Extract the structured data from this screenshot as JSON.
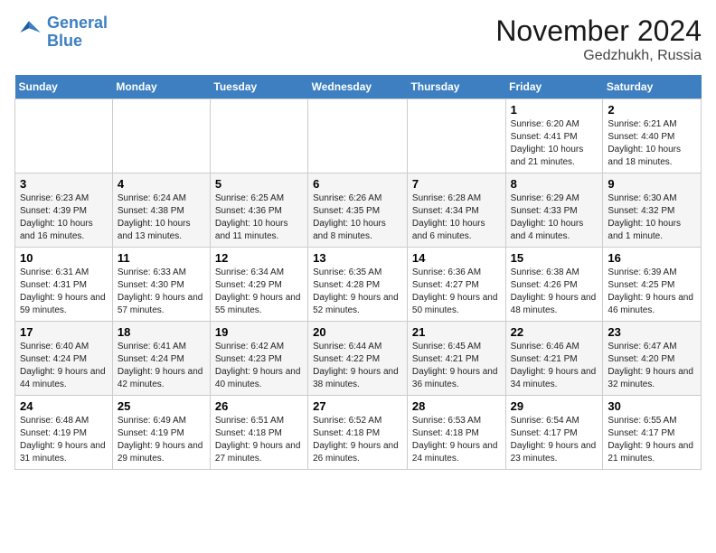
{
  "header": {
    "logo_line1": "General",
    "logo_line2": "Blue",
    "month_title": "November 2024",
    "location": "Gedzhukh, Russia"
  },
  "weekdays": [
    "Sunday",
    "Monday",
    "Tuesday",
    "Wednesday",
    "Thursday",
    "Friday",
    "Saturday"
  ],
  "weeks": [
    [
      {
        "day": "",
        "info": ""
      },
      {
        "day": "",
        "info": ""
      },
      {
        "day": "",
        "info": ""
      },
      {
        "day": "",
        "info": ""
      },
      {
        "day": "",
        "info": ""
      },
      {
        "day": "1",
        "info": "Sunrise: 6:20 AM\nSunset: 4:41 PM\nDaylight: 10 hours and 21 minutes."
      },
      {
        "day": "2",
        "info": "Sunrise: 6:21 AM\nSunset: 4:40 PM\nDaylight: 10 hours and 18 minutes."
      }
    ],
    [
      {
        "day": "3",
        "info": "Sunrise: 6:23 AM\nSunset: 4:39 PM\nDaylight: 10 hours and 16 minutes."
      },
      {
        "day": "4",
        "info": "Sunrise: 6:24 AM\nSunset: 4:38 PM\nDaylight: 10 hours and 13 minutes."
      },
      {
        "day": "5",
        "info": "Sunrise: 6:25 AM\nSunset: 4:36 PM\nDaylight: 10 hours and 11 minutes."
      },
      {
        "day": "6",
        "info": "Sunrise: 6:26 AM\nSunset: 4:35 PM\nDaylight: 10 hours and 8 minutes."
      },
      {
        "day": "7",
        "info": "Sunrise: 6:28 AM\nSunset: 4:34 PM\nDaylight: 10 hours and 6 minutes."
      },
      {
        "day": "8",
        "info": "Sunrise: 6:29 AM\nSunset: 4:33 PM\nDaylight: 10 hours and 4 minutes."
      },
      {
        "day": "9",
        "info": "Sunrise: 6:30 AM\nSunset: 4:32 PM\nDaylight: 10 hours and 1 minute."
      }
    ],
    [
      {
        "day": "10",
        "info": "Sunrise: 6:31 AM\nSunset: 4:31 PM\nDaylight: 9 hours and 59 minutes."
      },
      {
        "day": "11",
        "info": "Sunrise: 6:33 AM\nSunset: 4:30 PM\nDaylight: 9 hours and 57 minutes."
      },
      {
        "day": "12",
        "info": "Sunrise: 6:34 AM\nSunset: 4:29 PM\nDaylight: 9 hours and 55 minutes."
      },
      {
        "day": "13",
        "info": "Sunrise: 6:35 AM\nSunset: 4:28 PM\nDaylight: 9 hours and 52 minutes."
      },
      {
        "day": "14",
        "info": "Sunrise: 6:36 AM\nSunset: 4:27 PM\nDaylight: 9 hours and 50 minutes."
      },
      {
        "day": "15",
        "info": "Sunrise: 6:38 AM\nSunset: 4:26 PM\nDaylight: 9 hours and 48 minutes."
      },
      {
        "day": "16",
        "info": "Sunrise: 6:39 AM\nSunset: 4:25 PM\nDaylight: 9 hours and 46 minutes."
      }
    ],
    [
      {
        "day": "17",
        "info": "Sunrise: 6:40 AM\nSunset: 4:24 PM\nDaylight: 9 hours and 44 minutes."
      },
      {
        "day": "18",
        "info": "Sunrise: 6:41 AM\nSunset: 4:24 PM\nDaylight: 9 hours and 42 minutes."
      },
      {
        "day": "19",
        "info": "Sunrise: 6:42 AM\nSunset: 4:23 PM\nDaylight: 9 hours and 40 minutes."
      },
      {
        "day": "20",
        "info": "Sunrise: 6:44 AM\nSunset: 4:22 PM\nDaylight: 9 hours and 38 minutes."
      },
      {
        "day": "21",
        "info": "Sunrise: 6:45 AM\nSunset: 4:21 PM\nDaylight: 9 hours and 36 minutes."
      },
      {
        "day": "22",
        "info": "Sunrise: 6:46 AM\nSunset: 4:21 PM\nDaylight: 9 hours and 34 minutes."
      },
      {
        "day": "23",
        "info": "Sunrise: 6:47 AM\nSunset: 4:20 PM\nDaylight: 9 hours and 32 minutes."
      }
    ],
    [
      {
        "day": "24",
        "info": "Sunrise: 6:48 AM\nSunset: 4:19 PM\nDaylight: 9 hours and 31 minutes."
      },
      {
        "day": "25",
        "info": "Sunrise: 6:49 AM\nSunset: 4:19 PM\nDaylight: 9 hours and 29 minutes."
      },
      {
        "day": "26",
        "info": "Sunrise: 6:51 AM\nSunset: 4:18 PM\nDaylight: 9 hours and 27 minutes."
      },
      {
        "day": "27",
        "info": "Sunrise: 6:52 AM\nSunset: 4:18 PM\nDaylight: 9 hours and 26 minutes."
      },
      {
        "day": "28",
        "info": "Sunrise: 6:53 AM\nSunset: 4:18 PM\nDaylight: 9 hours and 24 minutes."
      },
      {
        "day": "29",
        "info": "Sunrise: 6:54 AM\nSunset: 4:17 PM\nDaylight: 9 hours and 23 minutes."
      },
      {
        "day": "30",
        "info": "Sunrise: 6:55 AM\nSunset: 4:17 PM\nDaylight: 9 hours and 21 minutes."
      }
    ]
  ]
}
